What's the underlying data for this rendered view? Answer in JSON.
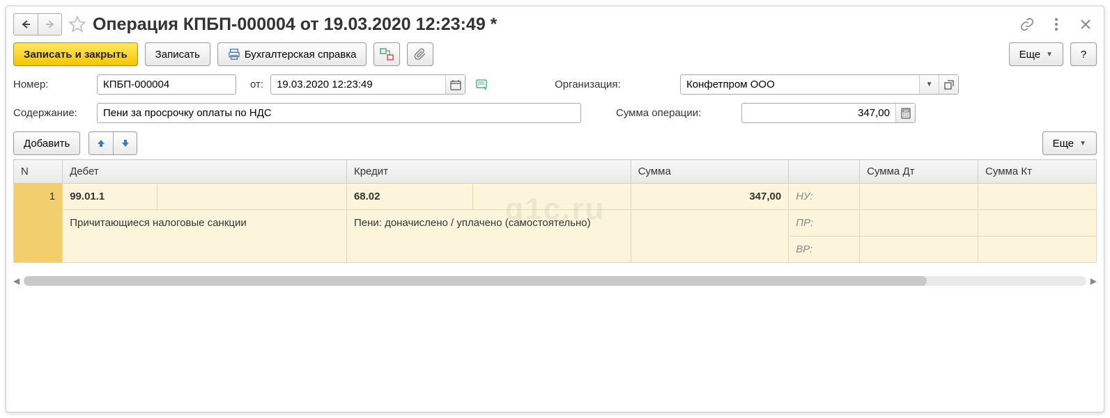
{
  "title": "Операция КПБП-000004 от 19.03.2020 12:23:49 *",
  "toolbar": {
    "save_close": "Записать и закрыть",
    "save": "Записать",
    "acc_ref": "Бухгалтерская справка",
    "more": "Еще",
    "help": "?"
  },
  "form": {
    "number_label": "Номер:",
    "number_value": "КПБП-000004",
    "date_label": "от:",
    "date_value": "19.03.2020 12:23:49",
    "org_label": "Организация:",
    "org_value": "Конфетпром ООО",
    "desc_label": "Содержание:",
    "desc_value": "Пени за просрочку оплаты по НДС",
    "sum_label": "Сумма операции:",
    "sum_value": "347,00"
  },
  "grid_toolbar": {
    "add": "Добавить",
    "more": "Еще"
  },
  "table": {
    "headers": {
      "n": "N",
      "debit": "Дебет",
      "credit": "Кредит",
      "sum": "Сумма",
      "sub": "",
      "sum_dt": "Сумма Дт",
      "sum_kt": "Сумма Кт"
    },
    "row": {
      "n": "1",
      "debit_acc": "99.01.1",
      "debit_desc": "Причитающиеся налоговые санкции",
      "credit_acc": "68.02",
      "credit_desc": "Пени: доначислено / уплачено (самостоятельно)",
      "sum": "347,00",
      "sub1": "НУ:",
      "sub2": "ПР:",
      "sub3": "ВР:"
    }
  },
  "watermark": "q1c.ru"
}
